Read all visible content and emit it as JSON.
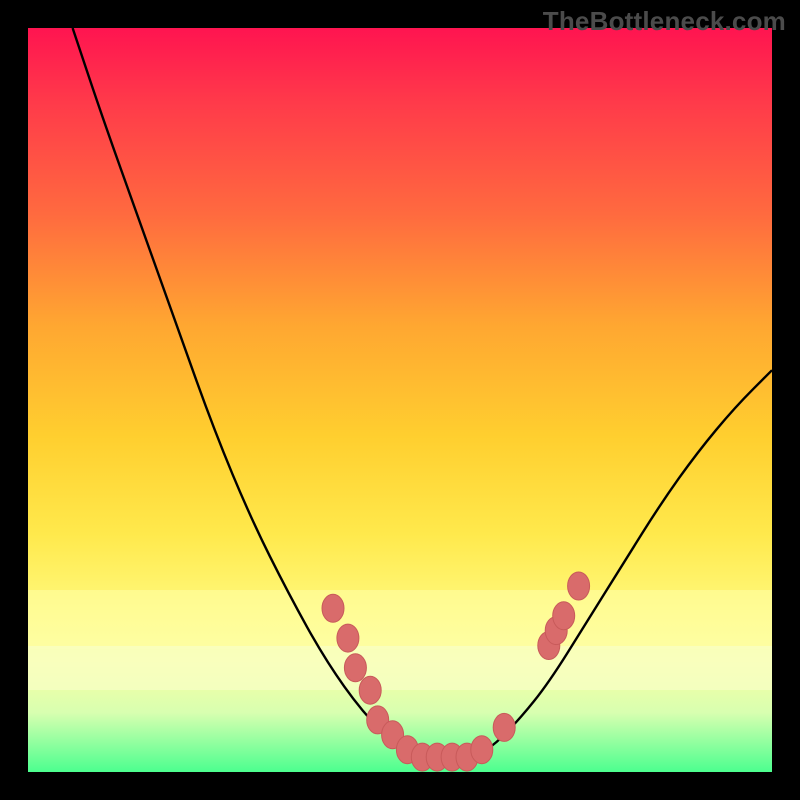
{
  "watermark": "TheBottleneck.com",
  "colors": {
    "curve_stroke": "#000000",
    "marker_fill": "#d96b6b",
    "marker_stroke": "#c85a5a"
  },
  "chart_data": {
    "type": "line",
    "title": "",
    "xlabel": "",
    "ylabel": "",
    "xlim": [
      0,
      100
    ],
    "ylim": [
      0,
      100
    ],
    "curve": [
      {
        "x": 6,
        "y": 100
      },
      {
        "x": 10,
        "y": 88
      },
      {
        "x": 15,
        "y": 74
      },
      {
        "x": 20,
        "y": 60
      },
      {
        "x": 25,
        "y": 46
      },
      {
        "x": 30,
        "y": 34
      },
      {
        "x": 35,
        "y": 24
      },
      {
        "x": 40,
        "y": 15
      },
      {
        "x": 45,
        "y": 8
      },
      {
        "x": 50,
        "y": 3
      },
      {
        "x": 54,
        "y": 1
      },
      {
        "x": 58,
        "y": 1
      },
      {
        "x": 62,
        "y": 3
      },
      {
        "x": 66,
        "y": 7
      },
      {
        "x": 70,
        "y": 12
      },
      {
        "x": 75,
        "y": 20
      },
      {
        "x": 80,
        "y": 28
      },
      {
        "x": 85,
        "y": 36
      },
      {
        "x": 90,
        "y": 43
      },
      {
        "x": 95,
        "y": 49
      },
      {
        "x": 100,
        "y": 54
      }
    ],
    "markers": [
      {
        "x": 41,
        "y": 22
      },
      {
        "x": 43,
        "y": 18
      },
      {
        "x": 44,
        "y": 14
      },
      {
        "x": 46,
        "y": 11
      },
      {
        "x": 47,
        "y": 7
      },
      {
        "x": 49,
        "y": 5
      },
      {
        "x": 51,
        "y": 3
      },
      {
        "x": 53,
        "y": 2
      },
      {
        "x": 55,
        "y": 2
      },
      {
        "x": 57,
        "y": 2
      },
      {
        "x": 59,
        "y": 2
      },
      {
        "x": 61,
        "y": 3
      },
      {
        "x": 64,
        "y": 6
      },
      {
        "x": 70,
        "y": 17
      },
      {
        "x": 71,
        "y": 19
      },
      {
        "x": 72,
        "y": 21
      },
      {
        "x": 74,
        "y": 25
      }
    ]
  }
}
